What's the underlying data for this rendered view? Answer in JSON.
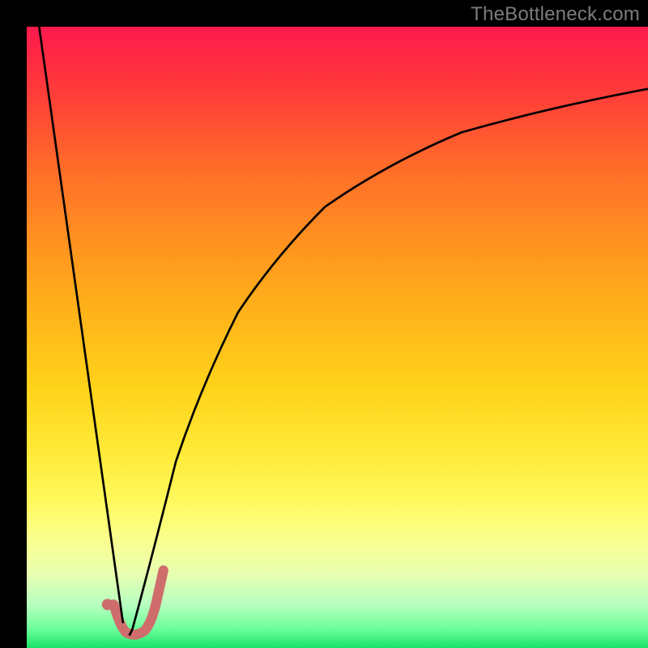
{
  "watermark": "TheBottleneck.com",
  "colors": {
    "curve_stroke": "#000000",
    "secondary_stroke": "#cf6d6d",
    "secondary_dot_fill": "#cf6d6d",
    "frame": "#000000"
  },
  "chart_data": {
    "type": "line",
    "title": "",
    "xlabel": "",
    "ylabel": "",
    "xlim": [
      0,
      100
    ],
    "ylim": [
      0,
      100
    ],
    "grid": false,
    "legend": false,
    "series": [
      {
        "name": "left-falling",
        "x": [
          2,
          15
        ],
        "y": [
          100,
          4
        ]
      },
      {
        "name": "right-rising-log",
        "x": [
          17,
          20,
          24,
          28,
          34,
          40,
          48,
          58,
          70,
          84,
          100
        ],
        "y": [
          2,
          14,
          30,
          42,
          54,
          63,
          71,
          78,
          83,
          87,
          90
        ]
      },
      {
        "name": "j-hook",
        "x": [
          14,
          15,
          16,
          17.5,
          19,
          20,
          21.5
        ],
        "y": [
          7,
          4,
          2.5,
          2,
          3,
          6,
          12
        ]
      }
    ],
    "marker": {
      "name": "dot",
      "x": 13,
      "y": 7,
      "r": 0.9
    }
  }
}
